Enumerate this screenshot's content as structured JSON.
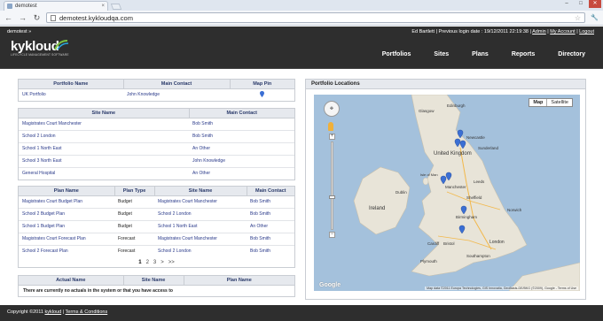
{
  "browser": {
    "tab_title": "demotest",
    "tab_close": "×",
    "url": "demotest.kykloudqa.com",
    "back": "←",
    "forward": "→",
    "reload": "↻",
    "star": "☆",
    "wrench": "🔧",
    "win_min": "–",
    "win_max": "□",
    "win_close": "✕"
  },
  "header": {
    "breadcrumb": "demotest »",
    "user_text": "Ed Bartlett | Previous login date : 19/12/2011 22:19:38 |",
    "admin_link": "Admin",
    "account_link": "My Account",
    "logout_link": "Logout",
    "separator": "|",
    "logo_word": "kykloud",
    "logo_tag": "LIFECYCLE MANAGEMENT SOFTWARE",
    "nav": [
      "Portfolios",
      "Sites",
      "Plans",
      "Reports",
      "Directory"
    ]
  },
  "portfolio_table": {
    "headers": [
      "Portfolio Name",
      "Main Contact",
      "Map Pin"
    ],
    "rows": [
      [
        "UK Portfolio",
        "John Knowledge",
        ""
      ]
    ]
  },
  "sites_table": {
    "headers": [
      "Site Name",
      "Main Contact"
    ],
    "rows": [
      [
        "Magistrates Court Manchester",
        "Bob Smith"
      ],
      [
        "School 2 London",
        "Bob Smith"
      ],
      [
        "School 1 North East",
        "An Other"
      ],
      [
        "School 3 North East",
        "John Knowledge"
      ],
      [
        "General Hospital",
        "An Other"
      ]
    ]
  },
  "plans_table": {
    "headers": [
      "Plan Name",
      "Plan Type",
      "Site Name",
      "Main Contact"
    ],
    "rows": [
      [
        "Magistrates Court Budget Plan",
        "Budget",
        "Magistrates Court Manchester",
        "Bob Smith"
      ],
      [
        "School 2 Budget Plan",
        "Budget",
        "School 2 London",
        "Bob Smith"
      ],
      [
        "School 1 Budget Plan",
        "Budget",
        "School 1 North East",
        "An Other"
      ],
      [
        "Magistrates Court Forecast Plan",
        "Forecast",
        "Magistrates Court Manchester",
        "Bob Smith"
      ],
      [
        "School 2 Forecast Plan",
        "Forecast",
        "School 2 London",
        "Bob Smith"
      ]
    ],
    "pager": [
      "1",
      "2",
      "3",
      ">",
      ">>"
    ]
  },
  "actuals_table": {
    "headers": [
      "Actual Name",
      "Site Name",
      "Plan Name"
    ],
    "message": "There are currently no actuals in the system or that you have access to"
  },
  "map": {
    "title": "Portfolio Locations",
    "type_map": "Map",
    "type_satellite": "Satellite",
    "labels": [
      "United Kingdom",
      "Sunderland",
      "Leeds",
      "Manchester",
      "Sheffield",
      "Birmingham",
      "London",
      "Dublin",
      "Cardiff",
      "Bristol",
      "Plymouth",
      "Southampton",
      "Norwich",
      "Newcastle",
      "Glasgow",
      "Edinburgh",
      "Isle of Man",
      "Ireland"
    ],
    "zoom_plus": "+",
    "zoom_minus": "−",
    "google": "Google",
    "attribution": "Map data ©2011 Europa Technologies, GIS Innovatia, GeoBasis-DE/BKG (©2009), Google - Terms of Use"
  },
  "footer": {
    "copyright": "Copyright ©2011",
    "brand_link": "kykloud",
    "terms_link": "Terms & Conditions",
    "separator": "|"
  },
  "colors": {
    "header_bg": "#2e2e2e",
    "table_header_bg": "#e6e9ee",
    "link": "#2a3a8a",
    "sea": "#a4c1dc",
    "land": "#e8e4d8",
    "pin": "#3b6fd4"
  }
}
